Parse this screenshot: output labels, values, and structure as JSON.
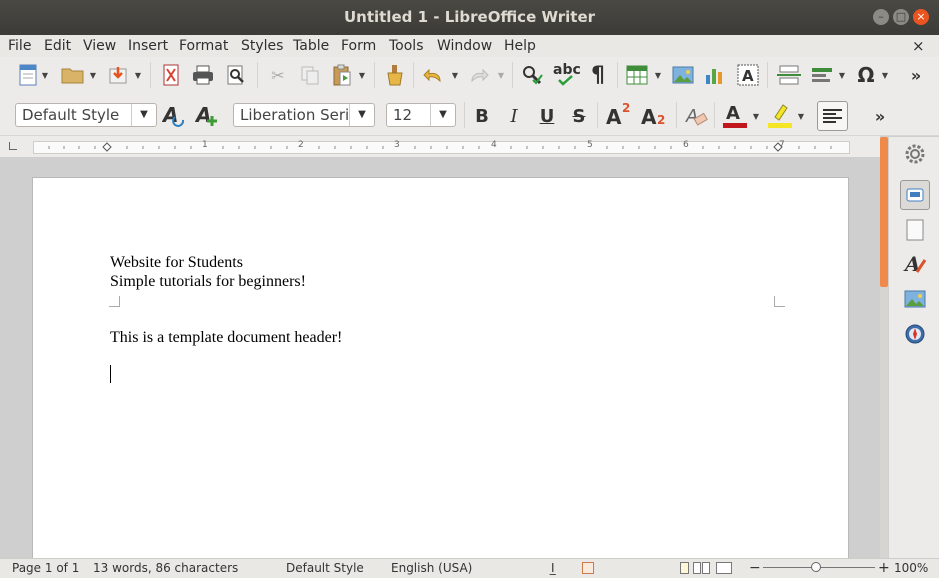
{
  "window": {
    "title": "Untitled 1 - LibreOffice Writer"
  },
  "menubar": {
    "items": [
      "File",
      "Edit",
      "View",
      "Insert",
      "Format",
      "Styles",
      "Table",
      "Form",
      "Tools",
      "Window",
      "Help"
    ],
    "close_glyph": "×"
  },
  "toolbar_standard": {
    "icons": [
      "new-document-icon",
      "open-folder-icon",
      "save-icon",
      "export-pdf-icon",
      "print-icon",
      "print-preview-icon",
      "cut-icon",
      "copy-icon",
      "paste-icon",
      "clone-formatting-icon",
      "undo-icon",
      "redo-icon",
      "find-replace-icon",
      "spellcheck-icon",
      "formatting-marks-icon",
      "insert-table-icon",
      "insert-image-icon",
      "insert-chart-icon",
      "insert-textbox-icon",
      "page-break-icon",
      "insert-field-icon",
      "special-character-icon"
    ],
    "spellcheck_label": "abc",
    "pilcrow": "¶",
    "omega": "Ω",
    "overflow": "»"
  },
  "toolbar_formatting": {
    "paragraph_style": "Default Style",
    "font_name": "Liberation Serif",
    "font_size": "12",
    "bold": "B",
    "italic": "I",
    "underline": "U",
    "strikethrough": "S",
    "superscript": "A",
    "superscript_mark": "2",
    "subscript": "A",
    "subscript_mark": "2",
    "font_color_letter": "A",
    "overflow": "»",
    "colors": {
      "font_color": "#c0161c",
      "highlight": "#f5e625"
    }
  },
  "ruler": {
    "numbers": [
      "1",
      "2",
      "3",
      "4",
      "5",
      "6",
      "7"
    ]
  },
  "document": {
    "lines": [
      "Website for Students",
      "Simple tutorials for beginners!",
      "This is a template document header!"
    ]
  },
  "sidebar": {
    "icons": [
      "properties-icon",
      "page-icon",
      "styles-icon",
      "gallery-icon",
      "navigator-icon"
    ]
  },
  "statusbar": {
    "page": "Page 1 of 1",
    "words": "13 words, 86 characters",
    "style": "Default Style",
    "language": "English (USA)",
    "zoom": "100%",
    "zoom_minus": "−",
    "zoom_plus": "+"
  },
  "colors": {
    "accent": "#f08a4b",
    "titlebar": "#3c3b37",
    "close_button": "#e95420"
  }
}
